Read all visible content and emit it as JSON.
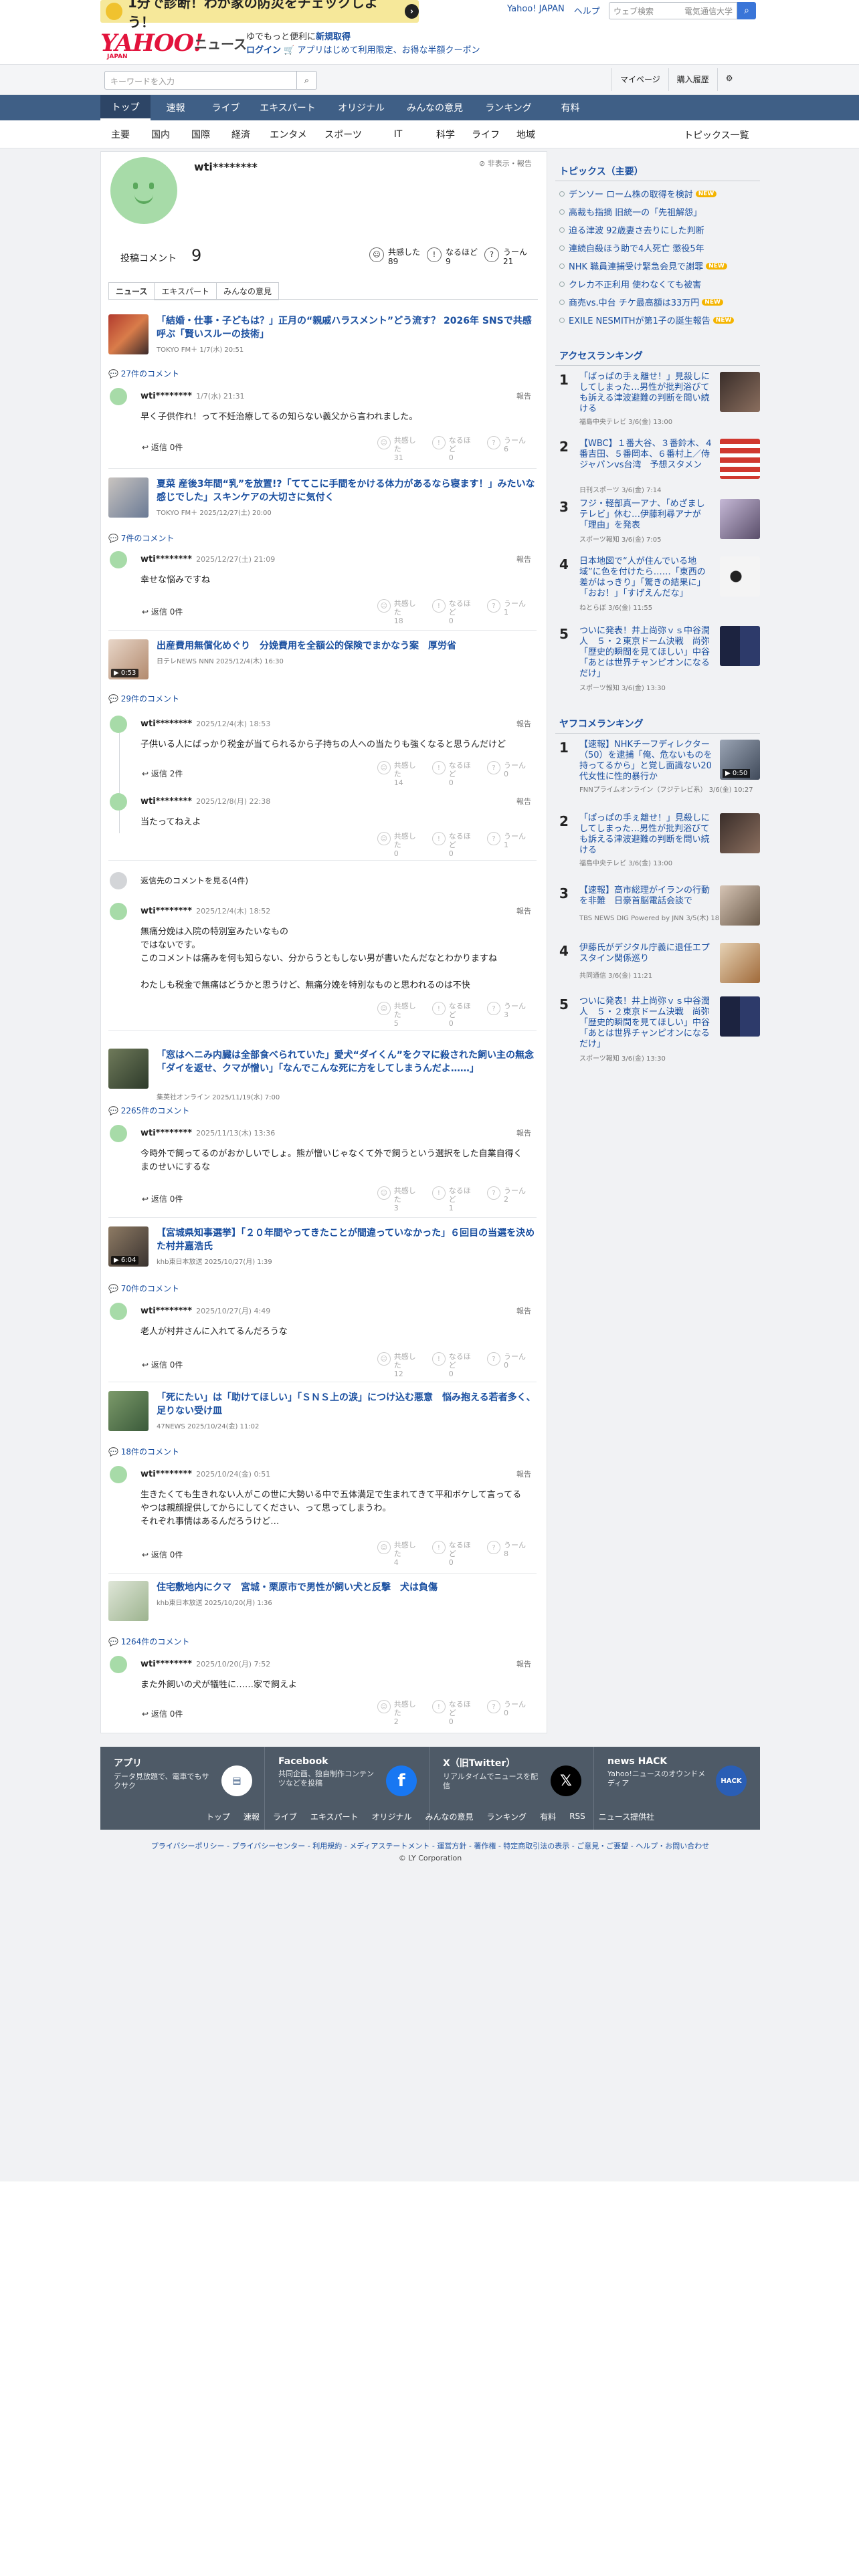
{
  "promo": {
    "text": "1分で診断！わが家の防災をチェックしよう！"
  },
  "toplinks": [
    "Yahoo! JAPAN",
    "ヘルプ"
  ],
  "websearch": {
    "placeholder": "ウェブ検索",
    "btn": "電気通信大学"
  },
  "logo": {
    "brand": "YAHOO!",
    "sub": "JAPAN",
    "news": "ニュース"
  },
  "hdrpromo": {
    "line1a": "ゆでもっと便利に",
    "line1b": "新規取得",
    "line2a": "ログイン",
    "line2b": "アプリはじめて利用限定、お得な半額クーポン"
  },
  "search": {
    "placeholder": "キーワードを入力"
  },
  "header_btns": [
    "マイページ",
    "購入履歴"
  ],
  "nav1": [
    "トップ",
    "速報",
    "ライブ",
    "エキスパート",
    "オリジナル",
    "みんなの意見",
    "ランキング",
    "有料"
  ],
  "nav2": [
    "主要",
    "国内",
    "国際",
    "経済",
    "エンタメ",
    "スポーツ",
    "IT",
    "科学",
    "ライフ",
    "地域"
  ],
  "nav2_all": "トピックス一覧",
  "profile": {
    "name": "wti********",
    "hide_note": "非表示・報告",
    "post_label": "投稿コメント",
    "post_count": "9",
    "stats": [
      {
        "icon": "☺",
        "label": "共感した",
        "value": "89"
      },
      {
        "icon": "!",
        "label": "なるほど",
        "value": "9"
      },
      {
        "icon": "?",
        "label": "うーん",
        "value": "21"
      }
    ]
  },
  "tabs": [
    "ニュース",
    "エキスパート",
    "みんなの意見"
  ],
  "common": {
    "reply": "返信 0件",
    "reply2": "返信 2件",
    "report": "報告",
    "r1": "共感した",
    "r2": "なるほど",
    "r3": "うーん",
    "more_replies": "返信先のコメントを見る(4件)"
  },
  "articles": [
    {
      "title": "「結婚・仕事・子どもは？」正月の“親戚ハラスメント”どう流す？ 2026年 SNSで共感呼ぶ「賢いスルーの技術」",
      "src": "TOKYO FM＋ 1/7(水) 20:51",
      "comments": "27件のコメント",
      "c": {
        "date": "1/7(水) 21:31",
        "body": "早く子供作れ！って不妊治療してるの知らない義父から言われました。",
        "r": [
          "31",
          "0",
          "6"
        ]
      }
    },
    {
      "title": "夏菜 産後3年間“乳”を放置!?「ててこに手間をかける体力があるなら寝ます！」みたいな感じでした」スキンケアの大切さに気付く",
      "src": "TOKYO FM＋ 2025/12/27(土) 20:00",
      "comments": "7件のコメント",
      "c": {
        "date": "2025/12/27(土) 21:09",
        "body": "幸せな悩みですね",
        "r": [
          "18",
          "0",
          "1"
        ]
      }
    },
    {
      "title": "出産費用無償化めぐり　分娩費用を全額公的保険でまかなう案　厚労省",
      "src": "日テレNEWS NNN 2025/12/4(木) 16:30",
      "comments": "29件のコメント",
      "video": "0:53",
      "c": {
        "date": "2025/12/4(木) 18:53",
        "body": "子供いる人にばっかり税金が当てられるから子持ちの人への当たりも強くなると思うんだけど",
        "r": [
          "14",
          "0",
          "0"
        ]
      },
      "c2": {
        "date": "2025/12/8(月) 22:38",
        "body": "当たってねえよ",
        "r": [
          "0",
          "0",
          "1"
        ]
      },
      "c3": {
        "date": "2025/12/4(木) 18:52",
        "body": "無痛分娩は入院の特別室みたいなもの\nではないです。\nこのコメントは痛みを何も知らない、分からうともしない男が書いたんだなとわかりますね\n\nわたしも税金で無痛はどうかと思うけど、無痛分娩を特別なものと思われるのは不快",
        "r": [
          "5",
          "0",
          "3"
        ]
      }
    },
    {
      "title": "「窓はヘニみ内臓は全部食べられていた」愛犬“ダイくん”をクマに殺された飼い主の無念「ダイを返せ、クマが憎い」「なんでこんな死に方をしてしまうんだよ……」",
      "src": "集英社オンライン 2025/11/19(水) 7:00",
      "comments": "2265件のコメント",
      "c": {
        "date": "2025/11/13(木) 13:36",
        "body": "今時外で飼ってるのがおかしいでしょ。熊が憎いじゃなくて外で飼うという選択をした自業自得くまのせいにするな",
        "r": [
          "3",
          "1",
          "2"
        ]
      }
    },
    {
      "title": "【宮城県知事選挙】「２０年間やってきたことが間違っていなかった」６回目の当選を決めた村井嘉浩氏",
      "src": "khb東日本放送 2025/10/27(月) 1:39",
      "comments": "70件のコメント",
      "video": "6:04",
      "c": {
        "date": "2025/10/27(月) 4:49",
        "body": "老人が村井さんに入れてるんだろうな",
        "r": [
          "12",
          "0",
          "0"
        ]
      }
    },
    {
      "title": "「死にたい」は「助けてほしい」「ＳＮＳ上の涙」につけ込む悪意　悩み抱える若者多く、足りない受け皿",
      "src": "47NEWS 2025/10/24(金) 11:02",
      "comments": "18件のコメント",
      "c": {
        "date": "2025/10/24(金) 0:51",
        "body": "生きたくても生きれない人がこの世に大勢いる中で五体満足で生まれてきて平和ボケして言ってるやつは親顔提供してからにしてください、って思ってしまうわ。\nそれぞれ事情はあるんだろうけど…",
        "r": [
          "4",
          "0",
          "8"
        ]
      }
    },
    {
      "title": "住宅敷地内にクマ　宮城・栗原市で男性が飼い犬と反撃　犬は負傷",
      "src": "khb東日本放送 2025/10/20(月) 1:36",
      "comments": "1264件のコメント",
      "c": {
        "date": "2025/10/20(月) 7:52",
        "body": "また外飼いの犬が犠牲に……家で飼えよ",
        "r": [
          "2",
          "0",
          "0"
        ]
      }
    }
  ],
  "sidebar": {
    "topics_head": "トピックス（主要）",
    "topics": [
      {
        "t": "デンソー ローム株の取得を検討",
        "new": "NEW"
      },
      {
        "t": "高裁も指摘 旧統一の「先祖解怨」",
        "new": ""
      },
      {
        "t": "迫る津波 92歳妻さ去りにした判断",
        "new": ""
      },
      {
        "t": "連続自殺ほう助で4人死亡 懲役5年",
        "new": ""
      },
      {
        "t": "NHK 職員連捕受け緊急会見で謝罪",
        "new": "NEW"
      },
      {
        "t": "クレカ不正利用 使わなくても被害",
        "new": ""
      },
      {
        "t": "商売vs.中台 チケ最高額は33万円",
        "new": "NEW"
      },
      {
        "t": "EXILE NESMITHが第1子の誕生報告",
        "new": "NEW"
      }
    ],
    "access_head": "アクセスランキング",
    "access": [
      {
        "n": "1",
        "t": "「ぱっぱの手ぇ離せ！」見殺しにしてしまった…男性が批判浴びても訴える津波避難の判断を問い続ける",
        "s": "福島中央テレビ 3/6(金) 13:00"
      },
      {
        "n": "2",
        "t": "【WBC】１番大谷、３番鈴木、４番吉田、５番岡本、６番村上／侍ジャパンvs台湾　予想スタメン",
        "s": "日刊スポーツ 3/6(金) 7:14"
      },
      {
        "n": "3",
        "t": "フジ・軽部真一アナ、「めざましテレビ」休む…伊藤利尋アナが「理由」を発表",
        "s": "スポーツ報知 3/6(金) 7:05"
      },
      {
        "n": "4",
        "t": "日本地図で“人が住んでいる地域”に色を付けたら……「東西の差がはっきり」「驚きの結果に」「おお！」「すげえんだな」",
        "s": "ねとらぼ 3/6(金) 11:55"
      },
      {
        "n": "5",
        "t": "ついに発表！井上尚弥ｖｓ中谷潤人　５・２東京ドーム決戦　尚弥「歴史的瞬間を見てほしい」中谷「あとは世界チャンピオンになるだけ」",
        "s": "スポーツ報知 3/6(金) 13:30"
      }
    ],
    "yafoo_head": "ヤフコメランキング",
    "yafoo": [
      {
        "n": "1",
        "t": "【速報】NHKチーフディレクター（50）を逮捕「俺、危ないものを持ってるから」と覚し面識ない20代女性に性的暴行か",
        "s": "FNNプライムオンライン（フジテレビ系） 3/6(金) 10:27",
        "video": "0:50"
      },
      {
        "n": "2",
        "t": "「ぱっぱの手ぇ離せ！」見殺しにしてしまった…男性が批判浴びても訴える津波避難の判断を問い続ける",
        "s": "福島中央テレビ 3/6(金) 13:00"
      },
      {
        "n": "3",
        "t": "【速報】高市総理がイランの行動を非難　日豪首脳電話会談で",
        "s": "TBS NEWS DIG Powered by JNN 3/5(木) 18:37"
      },
      {
        "n": "4",
        "t": "伊藤氏がデジタル庁義に退任エプスタイン関係巡り",
        "s": "共同通信 3/6(金) 11:21"
      },
      {
        "n": "5",
        "t": "ついに発表！井上尚弥ｖｓ中谷潤人　５・２東京ドーム決戦　尚弥「歴史的瞬間を見てほしい」中谷「あとは世界チャンピオンになるだけ」",
        "s": "スポーツ報知 3/6(金) 13:30"
      }
    ]
  },
  "footer": {
    "cells": [
      {
        "h": "アプリ",
        "d": "データ見放題で、電車でもサクサク"
      },
      {
        "h": "Facebook",
        "d": "共同企画、独自制作コンテンツなどを投稿"
      },
      {
        "h": "X（旧Twitter）",
        "d": "リアルタイムでニュースを配信"
      },
      {
        "h": "news HACK",
        "d": "Yahoo!ニュースのオウンドメディア"
      }
    ],
    "links": [
      "トップ",
      "速報",
      "ライブ",
      "エキスパート",
      "オリジナル",
      "みんなの意見",
      "ランキング",
      "有料",
      "RSS",
      "ニュース提供社"
    ],
    "legal": "プライバシーポリシー - プライバシーセンター - 利用規約 - メディアステートメント - 運営方針 - 著作権 - 特定商取引法の表示 - ご意見・ご要望 - ヘルプ・お問い合わせ",
    "copy": "© LY Corporation"
  }
}
